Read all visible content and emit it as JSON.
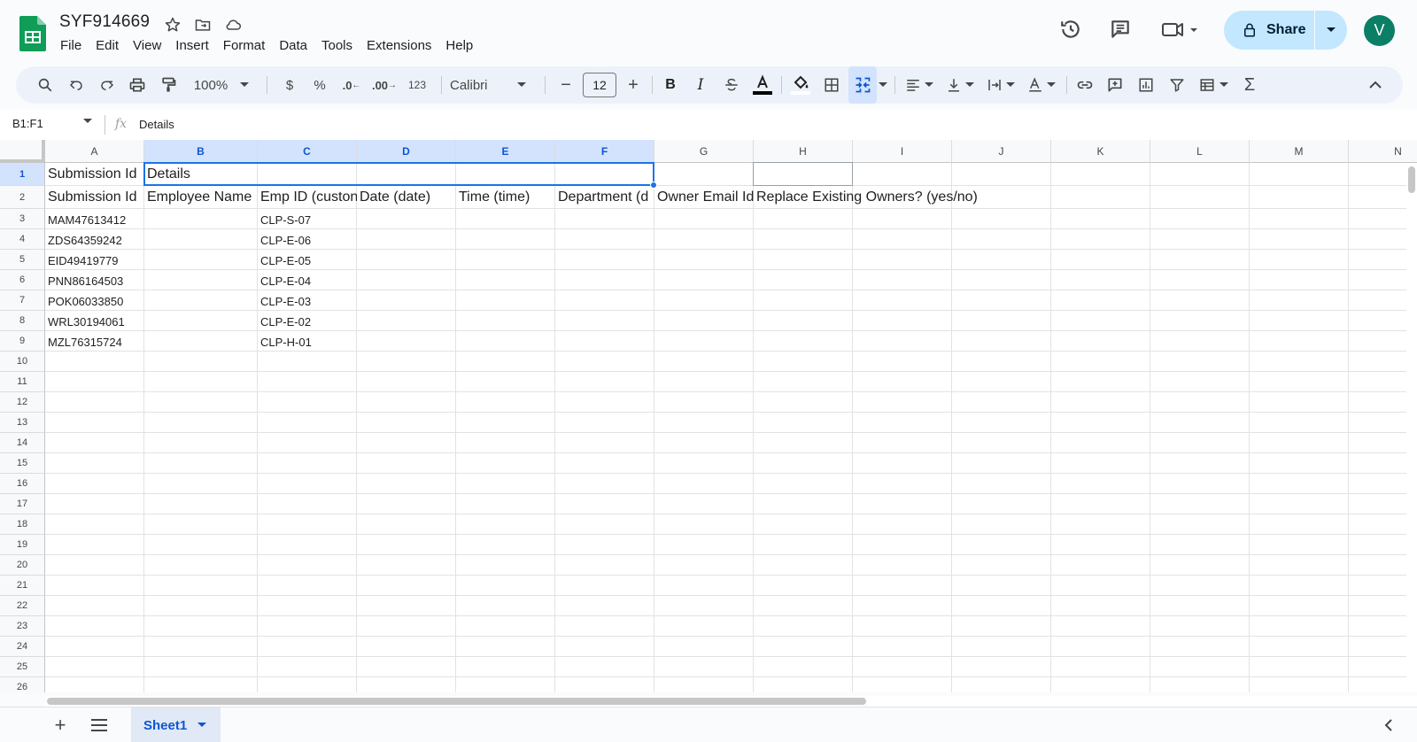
{
  "document": {
    "title": "SYF914669"
  },
  "menu": [
    "File",
    "Edit",
    "View",
    "Insert",
    "Format",
    "Data",
    "Tools",
    "Extensions",
    "Help"
  ],
  "header_right": {
    "share_label": "Share",
    "avatar_initial": "V"
  },
  "toolbar": {
    "zoom": "100%",
    "currency": "$",
    "percent": "%",
    "decrease_decimal": ".0",
    "increase_decimal": ".00",
    "more_formats": "123",
    "font": "Calibri",
    "font_size": "12"
  },
  "formula_bar": {
    "name_box": "B1:F1",
    "fx": "fx",
    "content": "Details"
  },
  "columns": [
    "A",
    "B",
    "C",
    "D",
    "E",
    "F",
    "G",
    "H",
    "I",
    "J",
    "K",
    "L",
    "M",
    "N"
  ],
  "selected_columns": [
    "B",
    "C",
    "D",
    "E",
    "F"
  ],
  "rows": [
    "1",
    "2",
    "3",
    "4",
    "5",
    "6",
    "7",
    "8",
    "9",
    "10",
    "11",
    "12",
    "13",
    "14",
    "15",
    "16",
    "17",
    "18",
    "19",
    "20",
    "21",
    "22",
    "23",
    "24",
    "25",
    "26"
  ],
  "cells": {
    "A1": "Submission Id",
    "B1": "Details",
    "A2": "Submission Id",
    "B2": "Employee Name",
    "C2": "Emp ID (custon",
    "D2": "Date (date)",
    "E2": "Time (time)",
    "F2": "Department (d",
    "G2": "Owner Email Id",
    "H2": "Replace Existing Owners? (yes/no)",
    "data_rows": [
      [
        "MAM47613412",
        "CLP-S-07"
      ],
      [
        "ZDS64359242",
        "CLP-E-06"
      ],
      [
        "EID49419779",
        "CLP-E-05"
      ],
      [
        "PNN86164503",
        "CLP-E-04"
      ],
      [
        "POK06033850",
        "CLP-E-03"
      ],
      [
        "WRL30194061",
        "CLP-E-02"
      ],
      [
        "MZL76315724",
        "CLP-H-01"
      ]
    ]
  },
  "sheet_tabs": [
    "Sheet1"
  ]
}
